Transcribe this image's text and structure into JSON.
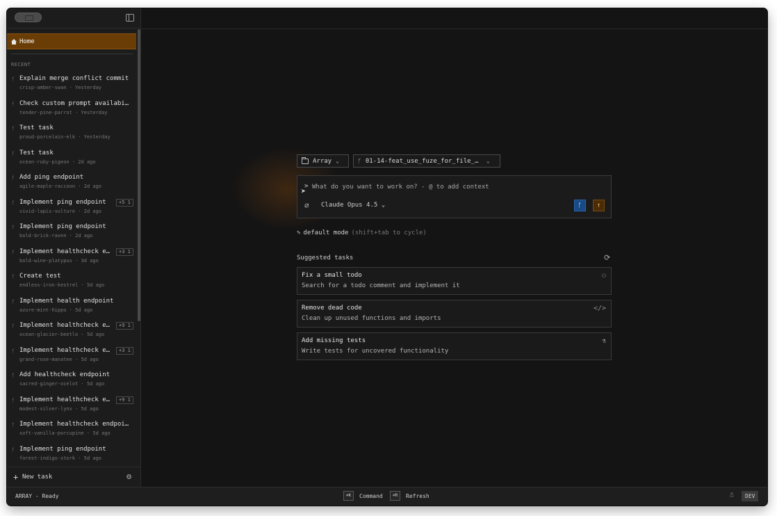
{
  "sidebar": {
    "home_label": "Home",
    "recent_label": "RECENT",
    "new_task_label": "New task",
    "tasks": [
      {
        "title": "Explain merge conflict commit",
        "slug": "crisp-amber-swan",
        "time": "Yesterday",
        "badge": ""
      },
      {
        "title": "Check custom prompt availabi…",
        "slug": "tender-pine-parrot",
        "time": "Yesterday",
        "badge": ""
      },
      {
        "title": "Test task",
        "slug": "proud-porcelain-elk",
        "time": "Yesterday",
        "badge": ""
      },
      {
        "title": "Test task",
        "slug": "ocean-ruby-pigeon",
        "time": "2d ago",
        "badge": ""
      },
      {
        "title": "Add ping endpoint",
        "slug": "agile-maple-raccoon",
        "time": "2d ago",
        "badge": ""
      },
      {
        "title": "Implement ping endpoint",
        "slug": "vivid-lapis-vulture",
        "time": "2d ago",
        "badge": "+5 1"
      },
      {
        "title": "Implement ping endpoint",
        "slug": "bold-brick-raven",
        "time": "2d ago",
        "badge": ""
      },
      {
        "title": "Implement healthcheck e…",
        "slug": "bold-wine-platypus",
        "time": "3d ago",
        "badge": "+3 1"
      },
      {
        "title": "Create test",
        "slug": "endless-iron-kestrel",
        "time": "5d ago",
        "badge": ""
      },
      {
        "title": "Implement health endpoint",
        "slug": "azure-mint-hippo",
        "time": "5d ago",
        "badge": ""
      },
      {
        "title": "Implement healthcheck e…",
        "slug": "ocean-glacier-beetle",
        "time": "5d ago",
        "badge": "+9 1"
      },
      {
        "title": "Implement healthcheck e…",
        "slug": "grand-rose-manatee",
        "time": "5d ago",
        "badge": "+3 1"
      },
      {
        "title": "Add healthcheck endpoint",
        "slug": "sacred-ginger-ocelot",
        "time": "5d ago",
        "badge": ""
      },
      {
        "title": "Implement healthcheck e…",
        "slug": "modest-silver-lynx",
        "time": "5d ago",
        "badge": "+9 1"
      },
      {
        "title": "Implement healthcheck endpoi…",
        "slug": "soft-vanilla-porcupine",
        "time": "5d ago",
        "badge": ""
      },
      {
        "title": "Implement ping endpoint",
        "slug": "forest-indigo-stork",
        "time": "5d ago",
        "badge": ""
      }
    ]
  },
  "main": {
    "repo_label": "Array",
    "branch_label": "01-14-feat_use_fuze_for_file_…",
    "prompt_prefix": ">",
    "prompt_placeholder": "What do you want to work on? - @ to add context",
    "model_label": "Claude Opus 4.5",
    "mode_label": "default mode",
    "mode_hint": "(shift+tab to cycle)",
    "suggested_header": "Suggested tasks",
    "suggestions": [
      {
        "title": "Fix a small todo",
        "desc": "Search for a todo comment and implement it",
        "icon": "bug-icon"
      },
      {
        "title": "Remove dead code",
        "desc": "Clean up unused functions and imports",
        "icon": "code-icon"
      },
      {
        "title": "Add missing tests",
        "desc": "Write tests for uncovered functionality",
        "icon": "flask-icon"
      }
    ]
  },
  "statusbar": {
    "app_status": "ARRAY - Ready",
    "command_key": "⌘K",
    "command_label": "Command",
    "refresh_key": "⌘R",
    "refresh_label": "Refresh",
    "env_badge": "DEV"
  },
  "colors": {
    "home_accent": "#6a3d07",
    "branch_button": "#174a86",
    "send_button": "#4a2c08"
  }
}
